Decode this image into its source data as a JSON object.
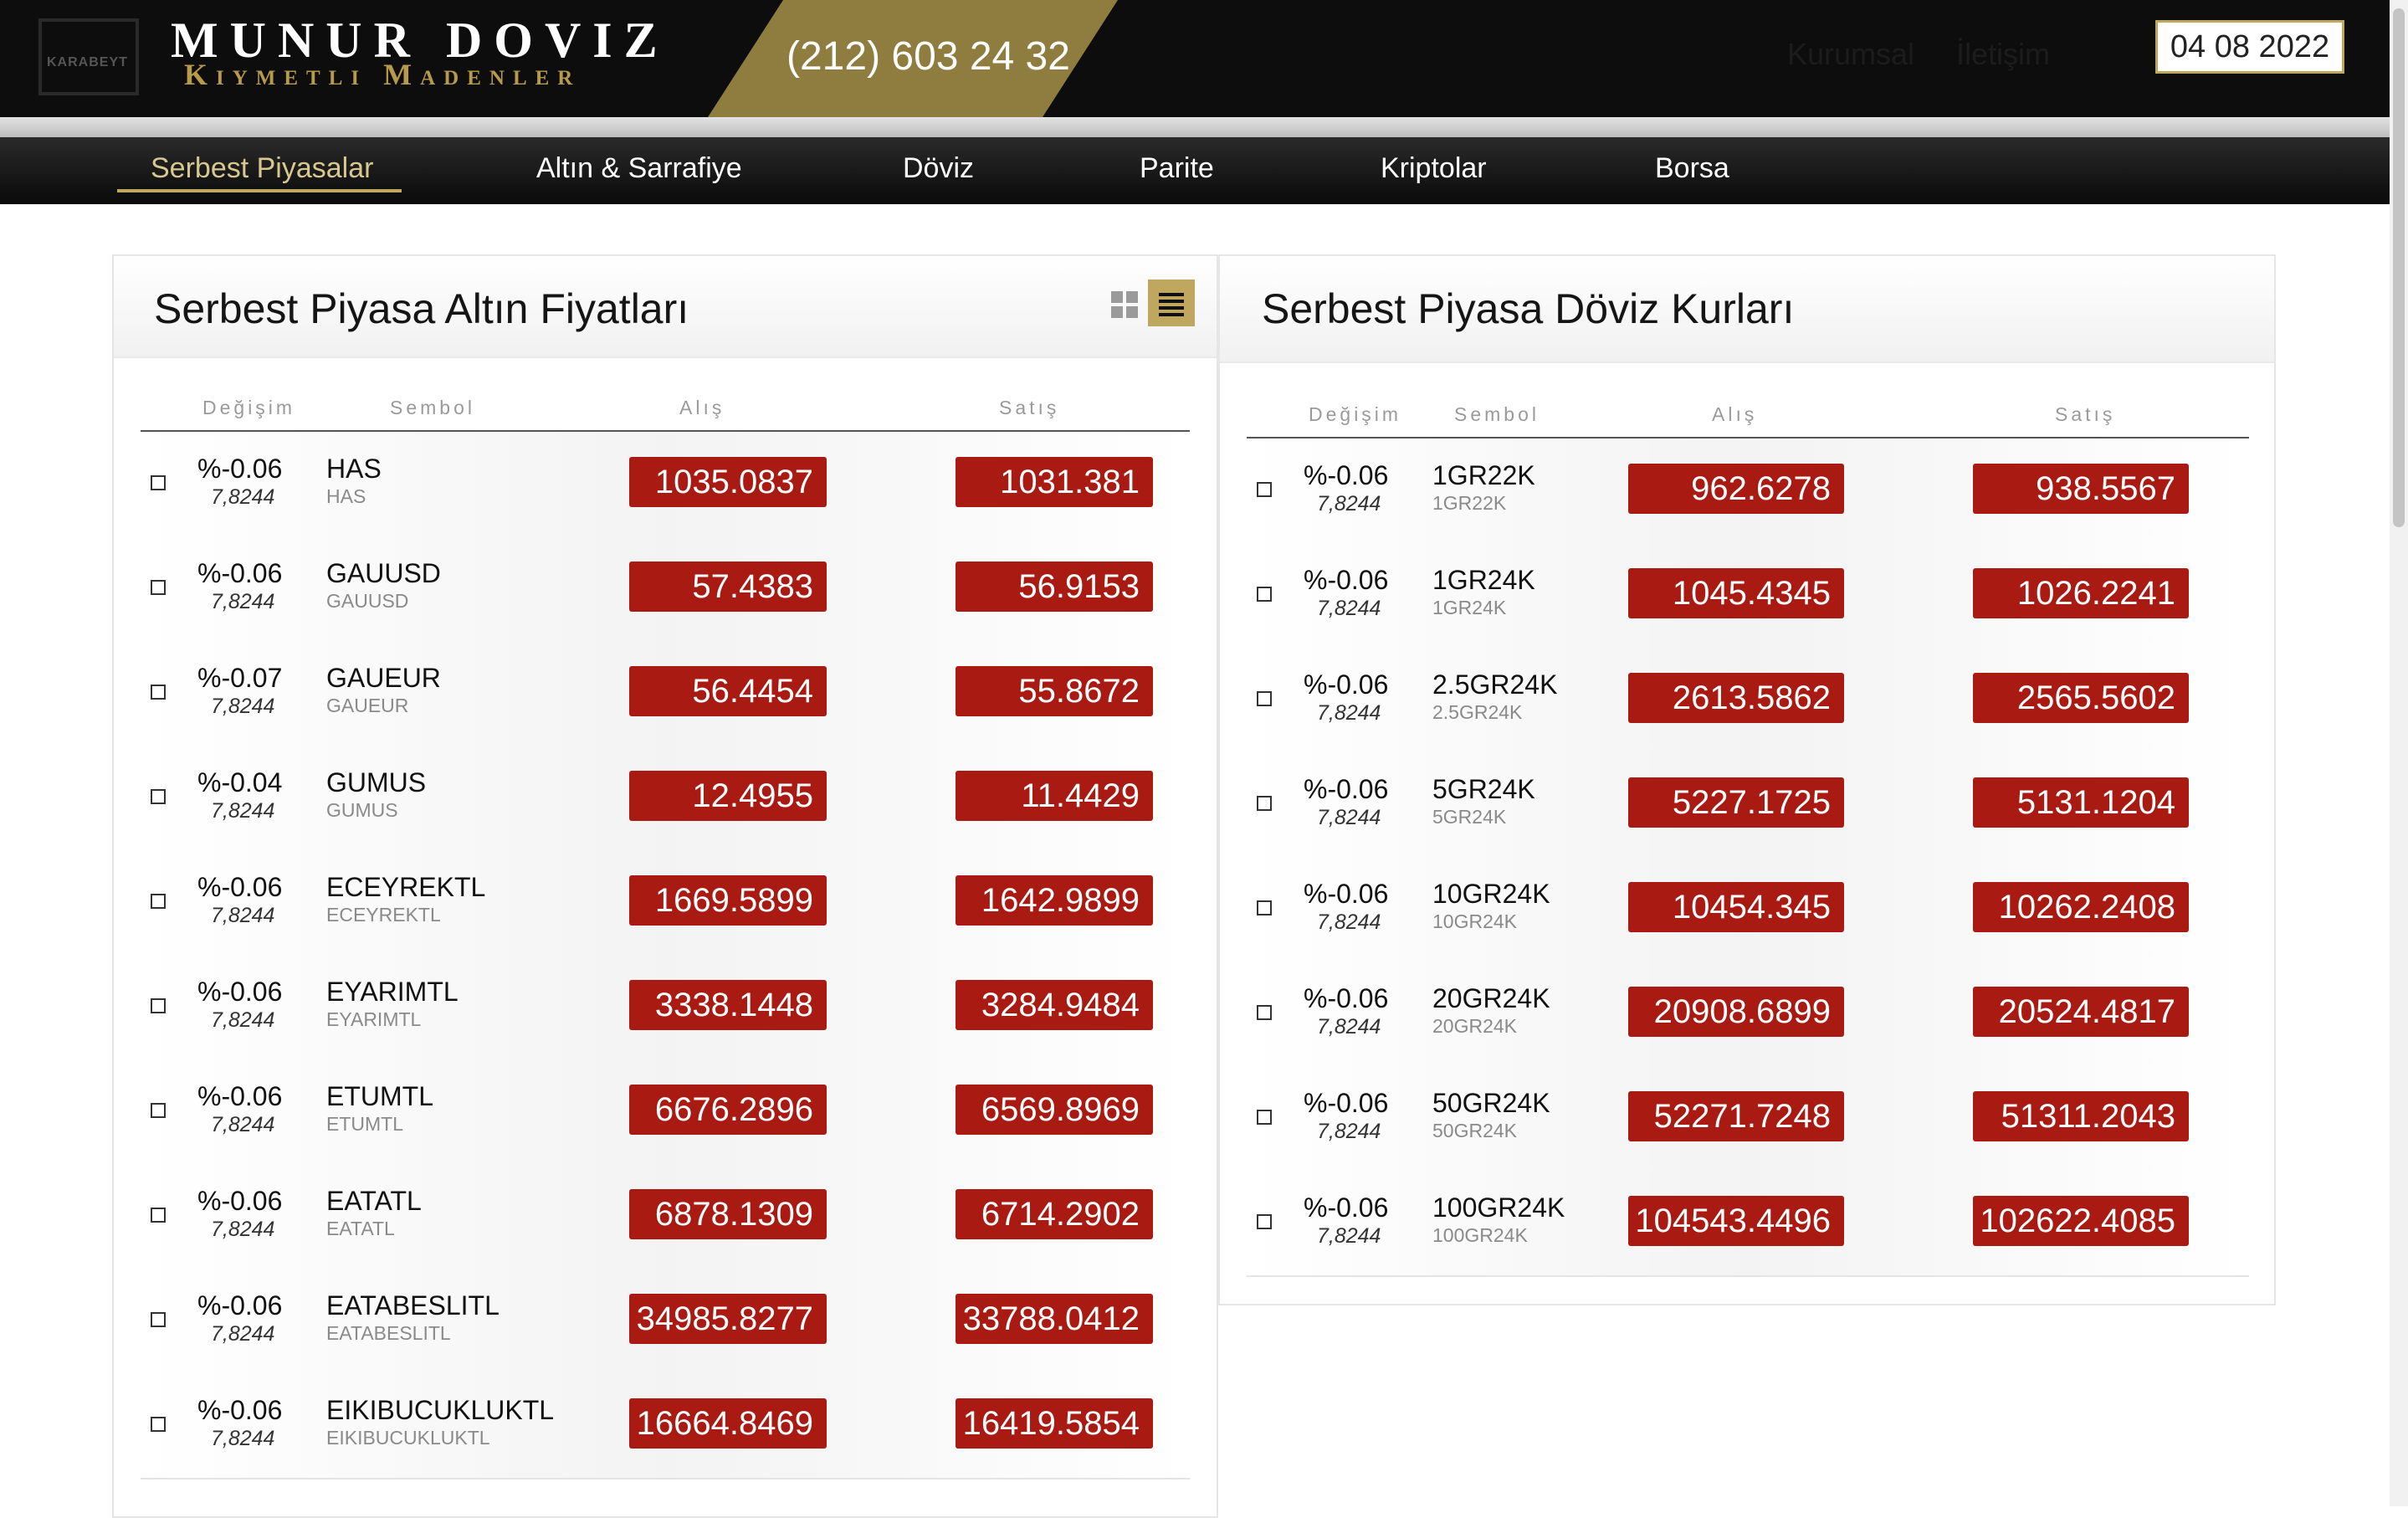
{
  "header": {
    "logo_text": "KARABEYT",
    "brand_title": "MUNUR DOVIZ",
    "brand_subtitle": "Kiymetli Madenler",
    "phone": "(212) 603 24 32",
    "links": [
      "Kurumsal",
      "İletişim"
    ],
    "date": "04 08 2022"
  },
  "nav": {
    "items": [
      "Serbest Piyasalar",
      "Altın & Sarrafiye",
      "Döviz",
      "Parite",
      "Kriptolar",
      "Borsa"
    ],
    "active": "Serbest Piyasalar"
  },
  "left_panel": {
    "title": "Serbest Piyasa Altın Fiyatları",
    "columns": [
      "Değişim",
      "Sembol",
      "Alış",
      "Satış"
    ],
    "rows": [
      {
        "change": "%-0.06",
        "change_sub": "7,8244",
        "symbol": "HAS",
        "symbol_sub": "HAS",
        "buy": "1035.0837",
        "sell": "1031.381"
      },
      {
        "change": "%-0.06",
        "change_sub": "7,8244",
        "symbol": "GAUUSD",
        "symbol_sub": "GAUUSD",
        "buy": "57.4383",
        "sell": "56.9153"
      },
      {
        "change": "%-0.07",
        "change_sub": "7,8244",
        "symbol": "GAUEUR",
        "symbol_sub": "GAUEUR",
        "buy": "56.4454",
        "sell": "55.8672"
      },
      {
        "change": "%-0.04",
        "change_sub": "7,8244",
        "symbol": "GUMUS",
        "symbol_sub": "GUMUS",
        "buy": "12.4955",
        "sell": "11.4429"
      },
      {
        "change": "%-0.06",
        "change_sub": "7,8244",
        "symbol": "ECEYREKTL",
        "symbol_sub": "ECEYREKTL",
        "buy": "1669.5899",
        "sell": "1642.9899"
      },
      {
        "change": "%-0.06",
        "change_sub": "7,8244",
        "symbol": "EYARIMTL",
        "symbol_sub": "EYARIMTL",
        "buy": "3338.1448",
        "sell": "3284.9484"
      },
      {
        "change": "%-0.06",
        "change_sub": "7,8244",
        "symbol": "ETUMTL",
        "symbol_sub": "ETUMTL",
        "buy": "6676.2896",
        "sell": "6569.8969"
      },
      {
        "change": "%-0.06",
        "change_sub": "7,8244",
        "symbol": "EATATL",
        "symbol_sub": "EATATL",
        "buy": "6878.1309",
        "sell": "6714.2902"
      },
      {
        "change": "%-0.06",
        "change_sub": "7,8244",
        "symbol": "EATABESLITL",
        "symbol_sub": "EATABESLITL",
        "buy": "34985.8277",
        "sell": "33788.0412"
      },
      {
        "change": "%-0.06",
        "change_sub": "7,8244",
        "symbol": "EIKIBUCUKLUKTL",
        "symbol_sub": "EIKIBUCUKLUKTL",
        "buy": "16664.8469",
        "sell": "16419.5854"
      }
    ]
  },
  "right_panel": {
    "title": "Serbest Piyasa Döviz Kurları",
    "columns": [
      "Değişim",
      "Sembol",
      "Alış",
      "Satış"
    ],
    "rows": [
      {
        "change": "%-0.06",
        "change_sub": "7,8244",
        "symbol": "1GR22K",
        "symbol_sub": "1GR22K",
        "buy": "962.6278",
        "sell": "938.5567"
      },
      {
        "change": "%-0.06",
        "change_sub": "7,8244",
        "symbol": "1GR24K",
        "symbol_sub": "1GR24K",
        "buy": "1045.4345",
        "sell": "1026.2241"
      },
      {
        "change": "%-0.06",
        "change_sub": "7,8244",
        "symbol": "2.5GR24K",
        "symbol_sub": "2.5GR24K",
        "buy": "2613.5862",
        "sell": "2565.5602"
      },
      {
        "change": "%-0.06",
        "change_sub": "7,8244",
        "symbol": "5GR24K",
        "symbol_sub": "5GR24K",
        "buy": "5227.1725",
        "sell": "5131.1204"
      },
      {
        "change": "%-0.06",
        "change_sub": "7,8244",
        "symbol": "10GR24K",
        "symbol_sub": "10GR24K",
        "buy": "10454.345",
        "sell": "10262.2408"
      },
      {
        "change": "%-0.06",
        "change_sub": "7,8244",
        "symbol": "20GR24K",
        "symbol_sub": "20GR24K",
        "buy": "20908.6899",
        "sell": "20524.4817"
      },
      {
        "change": "%-0.06",
        "change_sub": "7,8244",
        "symbol": "50GR24K",
        "symbol_sub": "50GR24K",
        "buy": "52271.7248",
        "sell": "51311.2043"
      },
      {
        "change": "%-0.06",
        "change_sub": "7,8244",
        "symbol": "100GR24K",
        "symbol_sub": "100GR24K",
        "buy": "104543.4496",
        "sell": "102622.4085"
      }
    ]
  },
  "colors": {
    "accent_gold": "#bfa760",
    "price_red": "#a91b12",
    "header_black": "#0d0d0d"
  },
  "icons": {
    "grid_view": "grid-icon",
    "list_view": "list-icon",
    "row_checkbox": "checkbox-icon"
  }
}
